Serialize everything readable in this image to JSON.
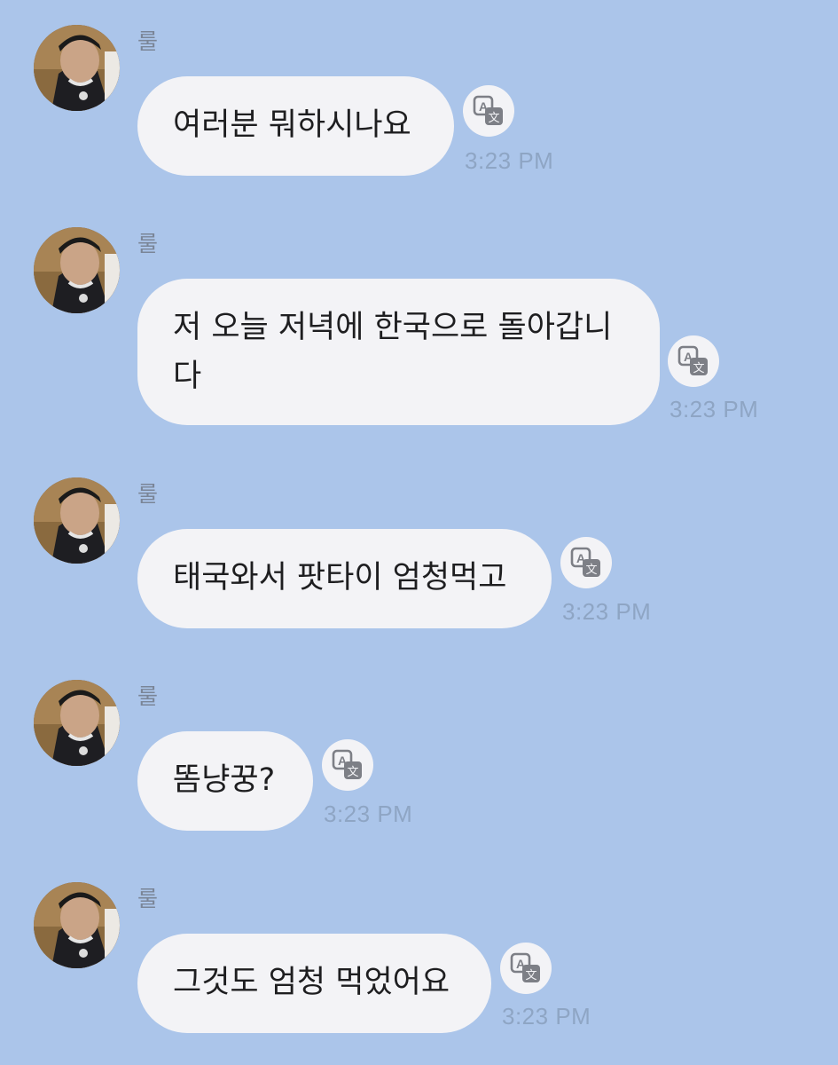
{
  "sender_name": "룰",
  "messages": [
    {
      "text": "여러분 뭐하시나요",
      "time": "3:23 PM",
      "translate_icon": "translate-icon"
    },
    {
      "text": "저 오늘 저녁에 한국으로 돌아갑니다",
      "line1": "저 오늘 저녁에 한국으로 돌아갑니",
      "line2": "다",
      "time": "3:23 PM",
      "translate_icon": "translate-icon"
    },
    {
      "text": "태국와서 팟타이 엄청먹고",
      "time": "3:23 PM",
      "translate_icon": "translate-icon"
    },
    {
      "text": "똠냥꿍?",
      "time": "3:23 PM",
      "translate_icon": "translate-icon"
    },
    {
      "text": "그것도 엄청 먹었어요",
      "time": "3:23 PM",
      "translate_icon": "translate-icon"
    }
  ],
  "colors": {
    "background": "#abc5ea",
    "bubble": "#f3f3f6",
    "timestamp": "#8ea5c4",
    "sender": "#7a8597"
  }
}
